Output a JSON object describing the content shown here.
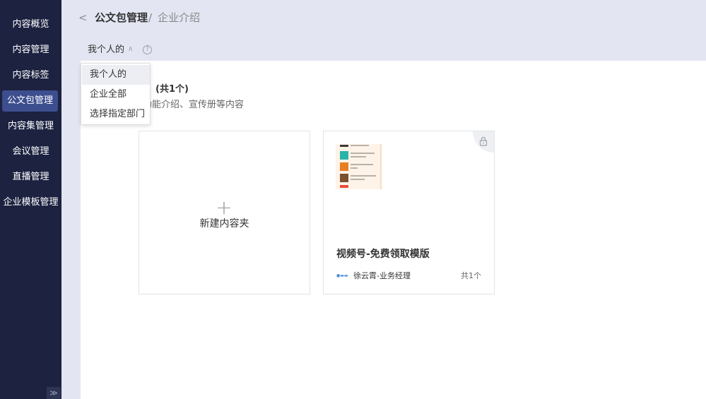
{
  "sidebar": {
    "items": [
      {
        "label": "内容概览"
      },
      {
        "label": "内容管理"
      },
      {
        "label": "内容标签"
      },
      {
        "label": "公文包管理"
      },
      {
        "label": "内容集管理"
      },
      {
        "label": "会议管理"
      },
      {
        "label": "直播管理"
      },
      {
        "label": "企业模板管理"
      }
    ],
    "active_index": 3
  },
  "header": {
    "breadcrumb_parent": "公文包管理",
    "breadcrumb_sep": "/",
    "breadcrumb_current": "企业介绍"
  },
  "filter": {
    "scope_label": "我个人的",
    "help_glyph": "?"
  },
  "dropdown": {
    "options": [
      "我个人的",
      "企业全部",
      "选择指定部门"
    ],
    "selected_index": 0
  },
  "section": {
    "title_suffix": "(共1个)",
    "desc_fragment": "功能介绍、宣传册等内容"
  },
  "cards": {
    "new_label": "新建内容夹",
    "folder": {
      "title": "视频号-免费领取模版",
      "owner": "徐云霄-业务经理",
      "count": "共1个"
    }
  },
  "colors": {
    "sidebar_bg": "#1c2240",
    "sidebar_active": "#3d4e8f",
    "topbar_bg": "#e3e6f2"
  }
}
